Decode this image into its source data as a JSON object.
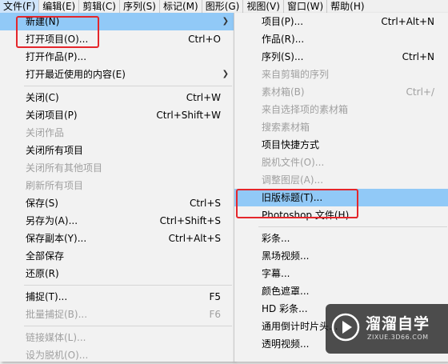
{
  "menubar": [
    "文件(F)",
    "编辑(E)",
    "剪辑(C)",
    "序列(S)",
    "标记(M)",
    "图形(G)",
    "视图(V)",
    "窗口(W)",
    "帮助(H)"
  ],
  "file_menu": {
    "new": {
      "label": "新建(N)"
    },
    "open_project": {
      "label": "打开项目(O)...",
      "shortcut": "Ctrl+O"
    },
    "open_production": {
      "label": "打开作品(P)..."
    },
    "open_recent": {
      "label": "打开最近使用的内容(E)"
    },
    "close": {
      "label": "关闭(C)",
      "shortcut": "Ctrl+W"
    },
    "close_project": {
      "label": "关闭项目(P)",
      "shortcut": "Ctrl+Shift+W"
    },
    "close_production": {
      "label": "关闭作品"
    },
    "close_all_projects": {
      "label": "关闭所有项目"
    },
    "close_other_projects": {
      "label": "关闭所有其他项目"
    },
    "refresh_all": {
      "label": "刷新所有项目"
    },
    "save": {
      "label": "保存(S)",
      "shortcut": "Ctrl+S"
    },
    "save_as": {
      "label": "另存为(A)...",
      "shortcut": "Ctrl+Shift+S"
    },
    "save_copy": {
      "label": "保存副本(Y)...",
      "shortcut": "Ctrl+Alt+S"
    },
    "save_all": {
      "label": "全部保存"
    },
    "revert": {
      "label": "还原(R)"
    },
    "capture": {
      "label": "捕捉(T)...",
      "shortcut": "F5"
    },
    "batch_capture": {
      "label": "批量捕捉(B)...",
      "shortcut": "F6"
    },
    "link_media": {
      "label": "链接媒体(L)..."
    },
    "make_offline": {
      "label": "设为脱机(O)..."
    }
  },
  "new_menu": {
    "project": {
      "label": "项目(P)...",
      "shortcut": "Ctrl+Alt+N"
    },
    "production": {
      "label": "作品(R)..."
    },
    "sequence": {
      "label": "序列(S)...",
      "shortcut": "Ctrl+N"
    },
    "seq_from_clip": {
      "label": "来自剪辑的序列"
    },
    "bin": {
      "label": "素材箱(B)",
      "shortcut": "Ctrl+/"
    },
    "bin_from_selection": {
      "label": "来自选择项的素材箱"
    },
    "search_bin": {
      "label": "搜索素材箱"
    },
    "project_shortcut": {
      "label": "项目快捷方式"
    },
    "offline_file": {
      "label": "脱机文件(O)..."
    },
    "adjustment_layer": {
      "label": "调整图层(A)..."
    },
    "legacy_title": {
      "label": "旧版标题(T)..."
    },
    "photoshop_file": {
      "label": "Photoshop 文件(H)..."
    },
    "bars_tone": {
      "label": "彩条..."
    },
    "black_video": {
      "label": "黑场视频..."
    },
    "captions": {
      "label": "字幕..."
    },
    "color_matte": {
      "label": "颜色遮罩..."
    },
    "hd_bars": {
      "label": "HD 彩条..."
    },
    "countdown": {
      "label": "通用倒计时片头..."
    },
    "transparent_video": {
      "label": "透明视频..."
    }
  },
  "watermark": {
    "name": "溜溜自学",
    "url": "ZIXUE.3D66.COM"
  },
  "colors": {
    "highlight": "#91c9f7",
    "annotation": "#e4262b"
  }
}
